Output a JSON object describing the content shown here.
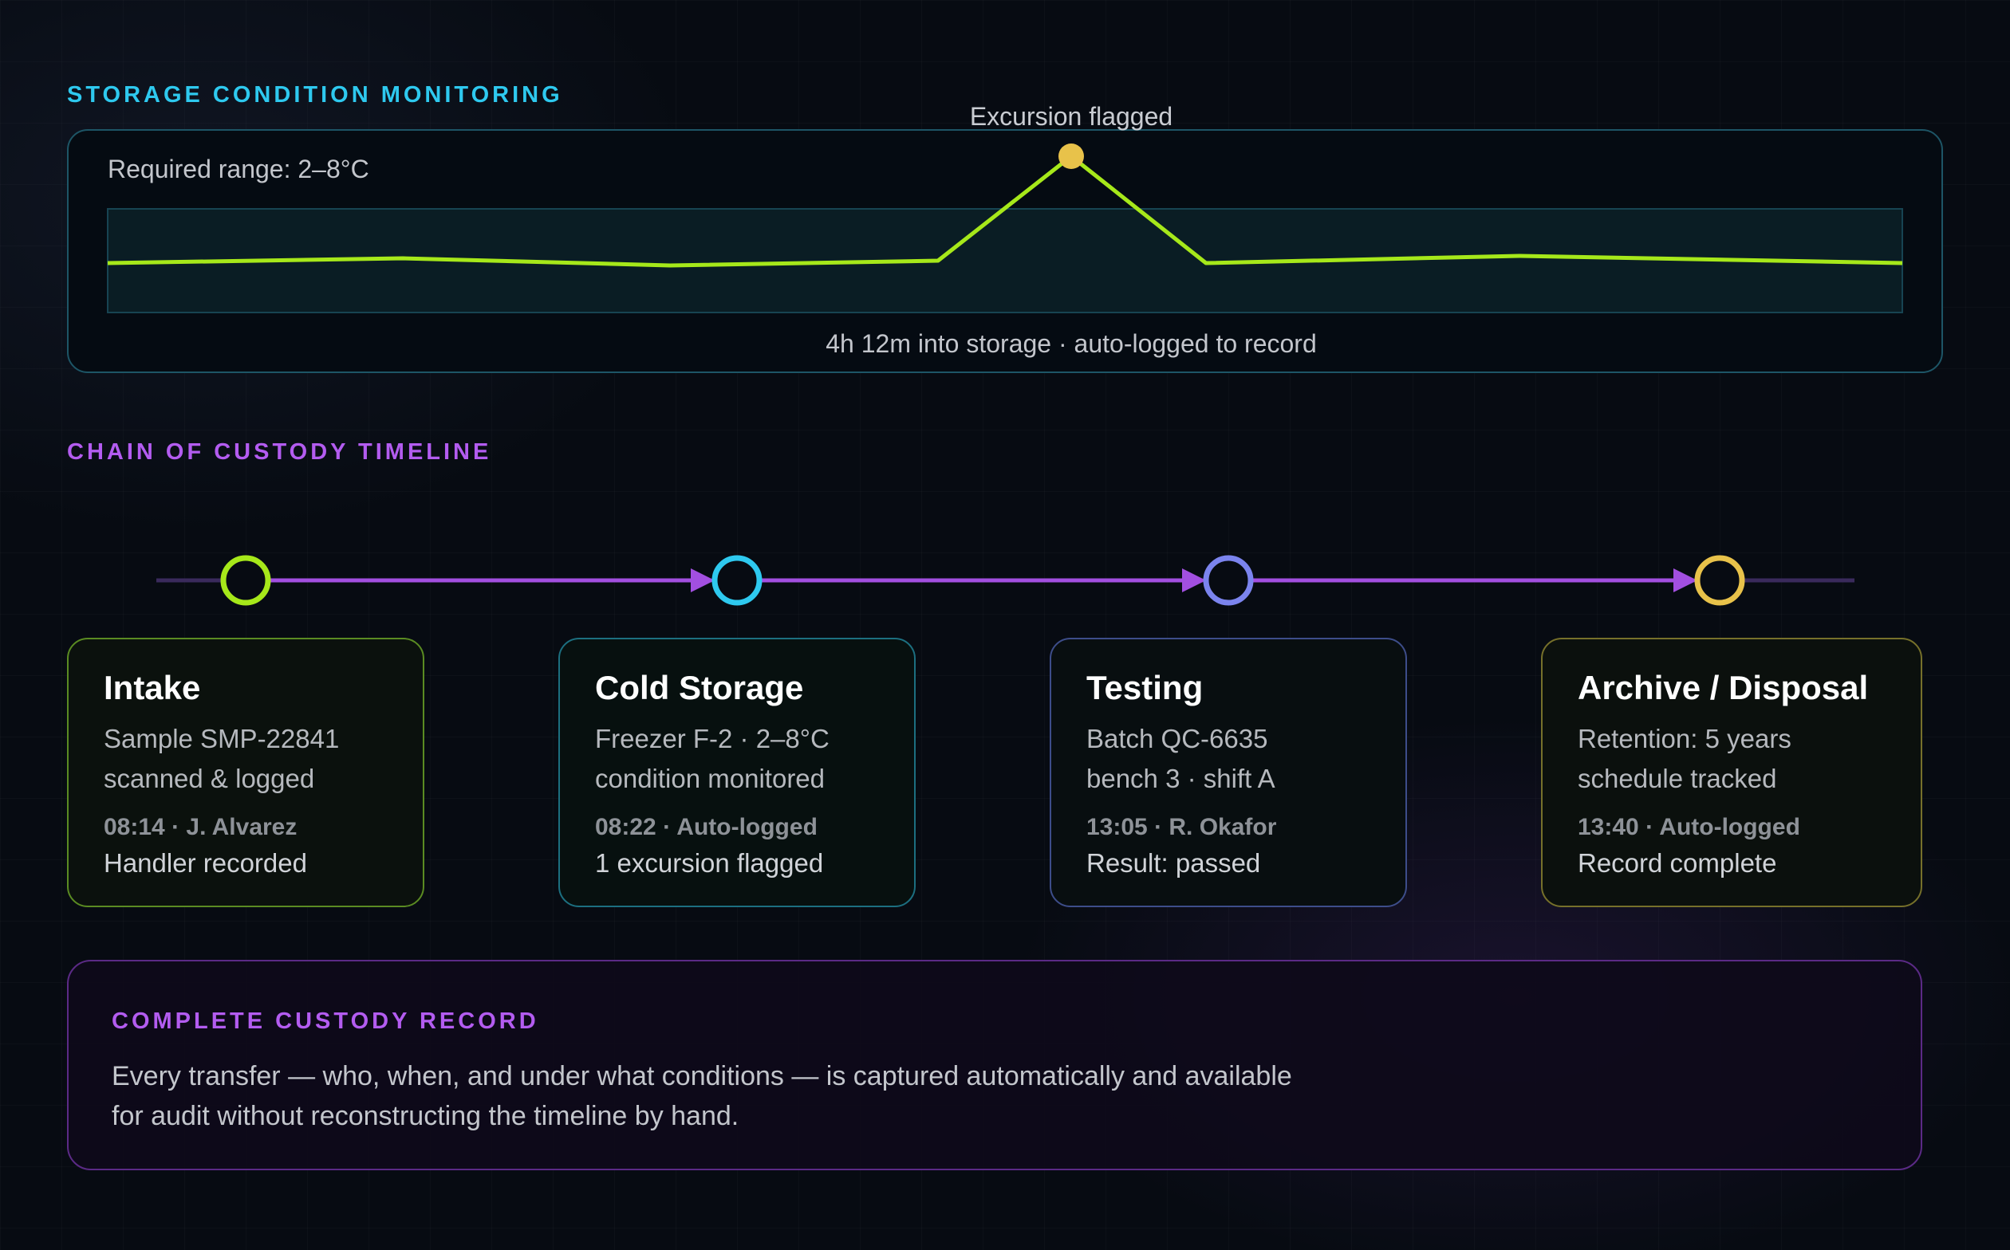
{
  "storage": {
    "title": "STORAGE CONDITION MONITORING",
    "range_label": "Required range: 2–8°C",
    "excursion_label": "Excursion flagged",
    "caption": "4h 12m into storage · auto-logged to record",
    "colors": {
      "line": "#a6e81a",
      "band": "#0a1d24",
      "marker": "#e8c24a",
      "border": "#1d5566"
    }
  },
  "timeline": {
    "title": "CHAIN OF CUSTODY TIMELINE",
    "colors": {
      "connector": "#a24fe0"
    },
    "stages": [
      {
        "title": "Intake",
        "line1": "Sample SMP-22841",
        "line2": "scanned & logged",
        "meta": "08:14 · J. Alvarez",
        "note": "Handler recorded",
        "color": "#a6e81a"
      },
      {
        "title": "Cold Storage",
        "line1": "Freezer F-2 · 2–8°C",
        "line2": "condition monitored",
        "meta": "08:22 · Auto-logged",
        "note": "1 excursion flagged",
        "color": "#2ec9ef"
      },
      {
        "title": "Testing",
        "line1": "Batch QC-6635",
        "line2": "bench 3 · shift A",
        "meta": "13:05 · R. Okafor",
        "note": "Result: passed",
        "color": "#7b84ee"
      },
      {
        "title": "Archive / Disposal",
        "line1": "Retention: 5 years",
        "line2": "schedule tracked",
        "meta": "13:40 · Auto-logged",
        "note": "Record complete",
        "color": "#e8c24a"
      }
    ]
  },
  "summary": {
    "title": "COMPLETE CUSTODY RECORD",
    "text": "Every transfer — who, when, and under what conditions — is captured automatically and available for audit without reconstructing the timeline by hand."
  }
}
